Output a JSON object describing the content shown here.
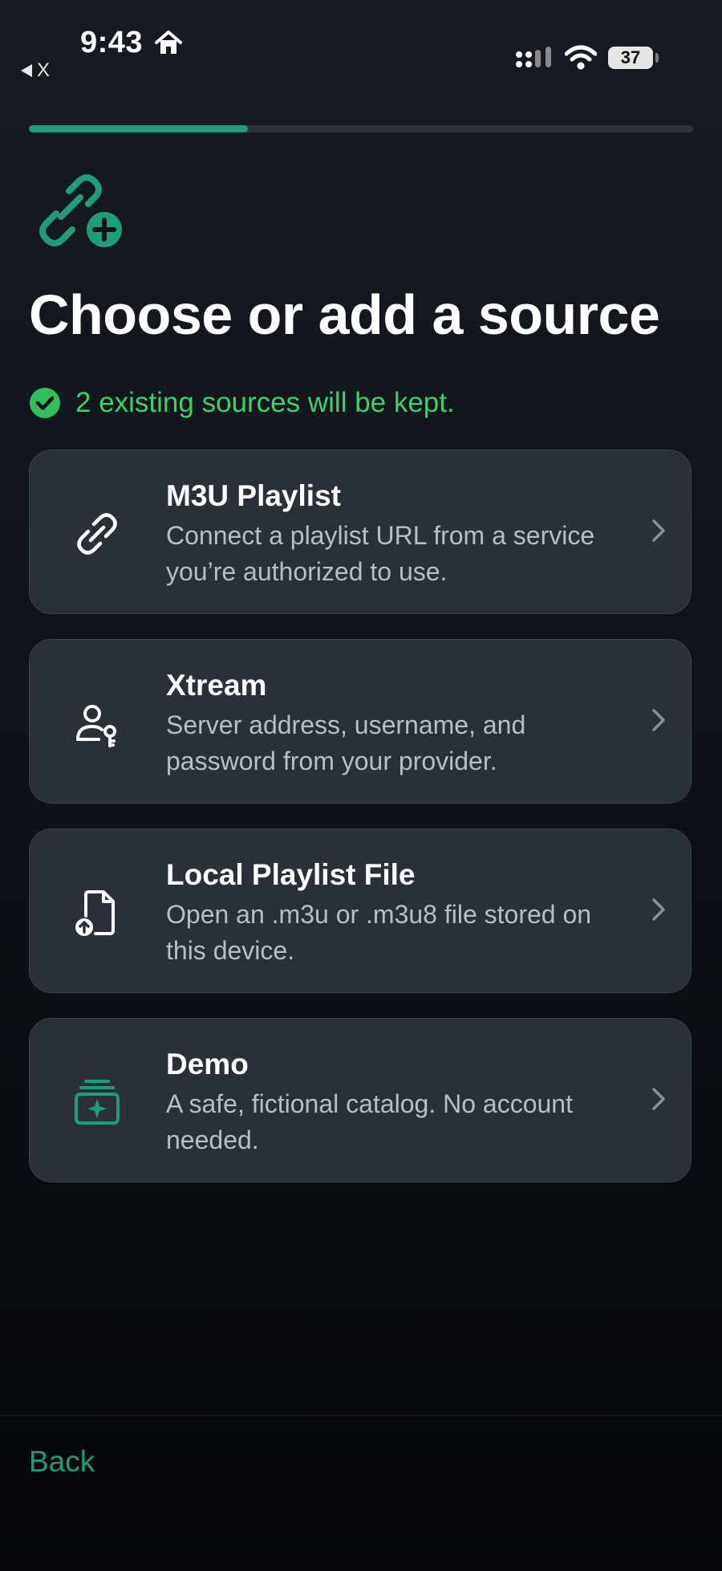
{
  "status_bar": {
    "time": "9:43",
    "back_app_label": "X",
    "battery_level": "37"
  },
  "progress": {
    "fraction": 0.33
  },
  "colors": {
    "accent": "#1f9d76",
    "success": "#3fcf6d",
    "card": "#2a3038"
  },
  "page": {
    "title": "Choose or add a source",
    "notice": "2 existing sources will be kept."
  },
  "sources": [
    {
      "title": "M3U Playlist",
      "description": "Connect a playlist URL from a service you’re authorized to use.",
      "icon": "link-icon"
    },
    {
      "title": "Xtream",
      "description": "Server address, username, and password from your provider.",
      "icon": "user-key-icon"
    },
    {
      "title": "Local Playlist File",
      "description": "Open an .m3u or .m3u8 file stored on this device.",
      "icon": "file-upload-icon"
    },
    {
      "title": "Demo",
      "description": "A safe, fictional catalog. No account needed.",
      "icon": "sparkle-stack-icon"
    }
  ],
  "footer": {
    "back_label": "Back"
  }
}
